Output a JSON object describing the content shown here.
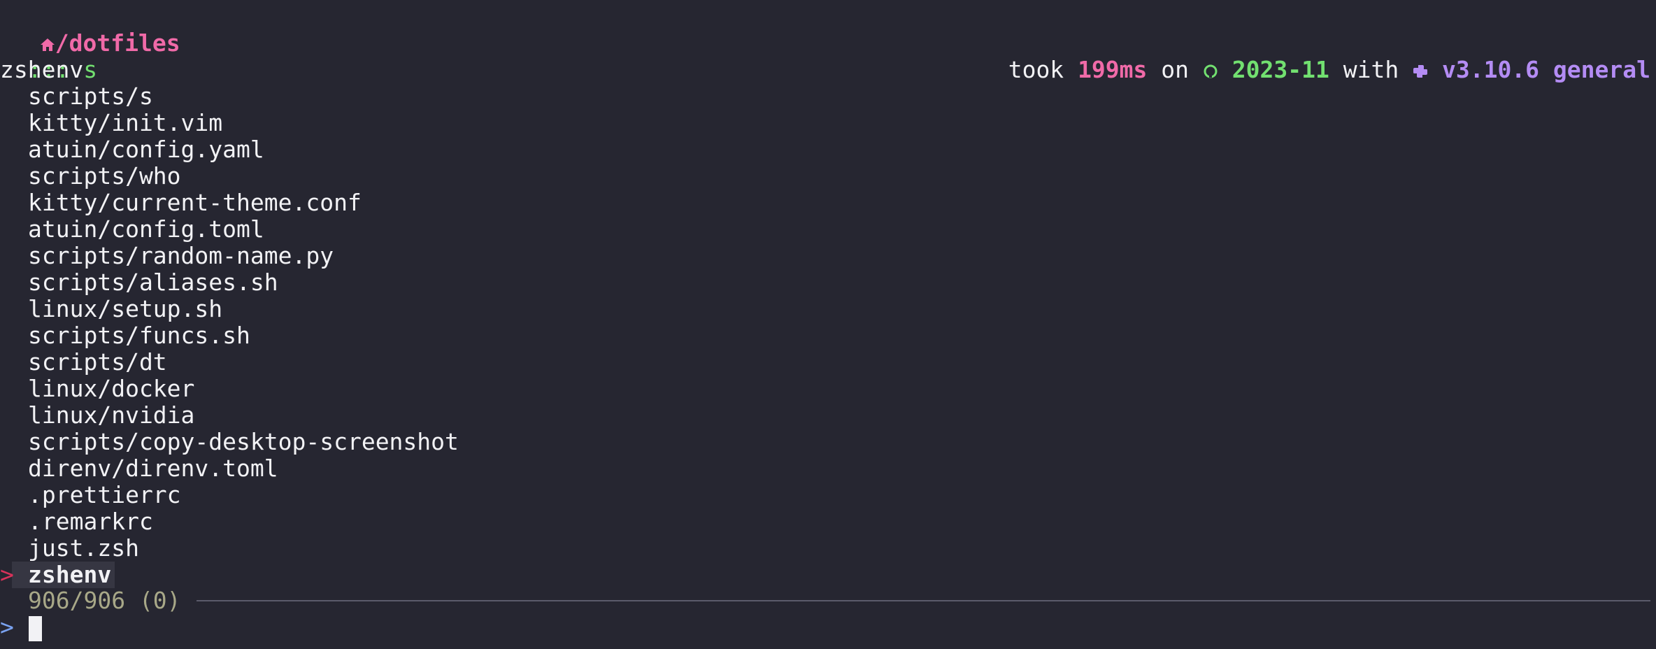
{
  "prompt": {
    "home_icon": "home-icon",
    "path": "/dotfiles",
    "indicator": ":::",
    "command": "s",
    "took_label": "took",
    "duration": "199ms",
    "on_label": "on",
    "branch_icon": "github-branch-icon",
    "branch": "2023-11",
    "with_label": "with",
    "python_icon": "python-icon",
    "python_version": "v3.10.6",
    "env_name": "general"
  },
  "query_echo": "zshenv",
  "results": [
    "scripts/s",
    "kitty/init.vim",
    "atuin/config.yaml",
    "scripts/who",
    "kitty/current-theme.conf",
    "atuin/config.toml",
    "scripts/random-name.py",
    "scripts/aliases.sh",
    "linux/setup.sh",
    "scripts/funcs.sh",
    "scripts/dt",
    "linux/docker",
    "linux/nvidia",
    "scripts/copy-desktop-screenshot",
    "direnv/direnv.toml",
    ".prettierrc",
    ".remarkrc",
    "just.zsh"
  ],
  "selected": {
    "marker": ">",
    "label": "zshenv"
  },
  "counter": "906/906 (0)",
  "input": {
    "prompt_symbol": ">",
    "value": ""
  },
  "colors": {
    "background": "#262631",
    "accent_pink": "#f06aa8",
    "accent_green": "#72e070",
    "accent_purple": "#b48cf4",
    "selection_marker": "#d8325a"
  }
}
